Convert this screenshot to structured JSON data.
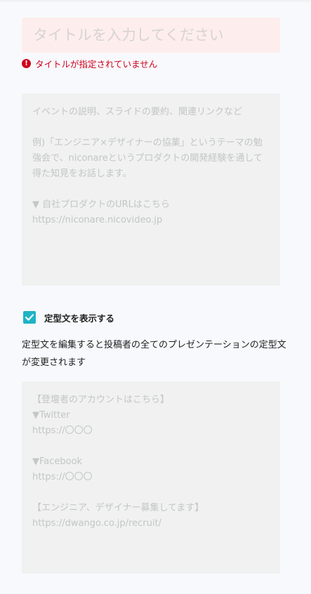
{
  "title": {
    "placeholder": "タイトルを入力してください",
    "value": ""
  },
  "error": {
    "message": "タイトルが指定されていません",
    "icon": "exclamation-icon",
    "color": "#d0021b"
  },
  "description": {
    "placeholder": "イベントの説明、スライドの要約、関連リンクなど\n\n例)「エンジニア×デザイナーの協業」というテーマの勉強会で、niconareというプロダクトの開発経験を通して得た知見をお話します。\n\n▼ 自社プロダクトのURLはこちら\nhttps://niconare.nicovideo.jp",
    "value": ""
  },
  "template_toggle": {
    "label": "定型文を表示する",
    "checked": true,
    "accent_color": "#1fb3c6"
  },
  "template_notice": "定型文を編集すると投稿者の全てのプレゼンテーションの定型文が変更されます",
  "template": {
    "placeholder": "【登壇者のアカウントはこちら】\n▼Twitter\nhttps://〇〇〇\n\n▼Facebook\nhttps://〇〇〇\n\n【エンジニア、デザイナー募集してます】\nhttps://dwango.co.jp/recruit/",
    "value": ""
  }
}
